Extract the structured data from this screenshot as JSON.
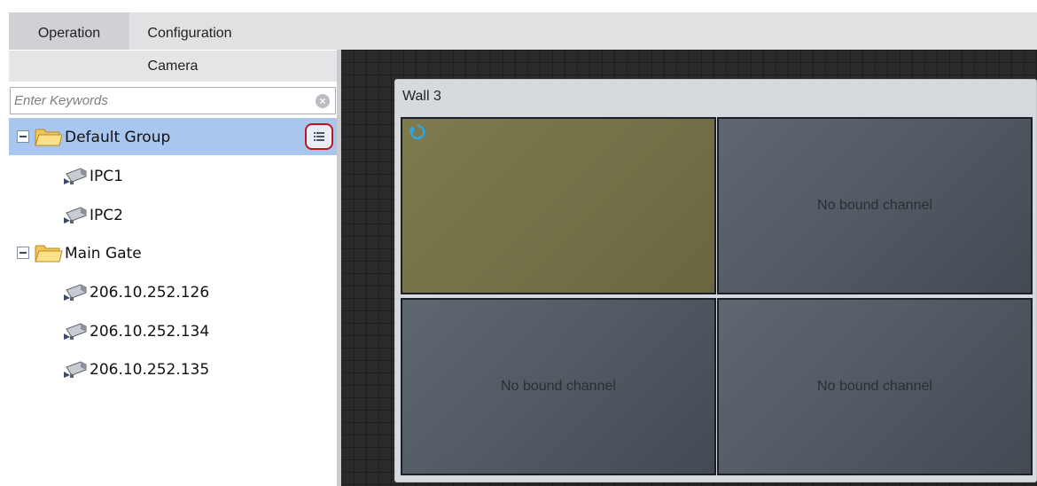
{
  "tabs": [
    {
      "label": "Operation",
      "active": true
    },
    {
      "label": "Configuration",
      "active": false
    }
  ],
  "camera_panel": {
    "title": "Camera",
    "search": {
      "placeholder": "Enter Keywords",
      "value": ""
    },
    "tree": [
      {
        "label": "Default Group",
        "type": "group",
        "expanded": true,
        "selected": true
      },
      {
        "label": "IPC1",
        "type": "camera"
      },
      {
        "label": "IPC2",
        "type": "camera"
      },
      {
        "label": "Main Gate",
        "type": "group",
        "expanded": true,
        "selected": false
      },
      {
        "label": "206.10.252.126",
        "type": "camera"
      },
      {
        "label": "206.10.252.134",
        "type": "camera"
      },
      {
        "label": "206.10.252.135",
        "type": "camera"
      }
    ]
  },
  "wall": {
    "title": "Wall 3",
    "cells": [
      {
        "text": "",
        "state": "active"
      },
      {
        "text": "No bound channel",
        "state": "unbound"
      },
      {
        "text": "No bound channel",
        "state": "unbound"
      },
      {
        "text": "No bound channel",
        "state": "unbound"
      }
    ]
  },
  "colors": {
    "selection": "#a8c6ee",
    "highlight_ring": "#c0141e",
    "active_cell": "#7f7b4f",
    "canvas": "#2a2a2a",
    "refresh_icon": "#2aa7e8"
  },
  "icons": [
    "folder-icon",
    "camera-icon",
    "list-menu-icon",
    "clear-icon",
    "refresh-icon",
    "collapse-icon"
  ]
}
